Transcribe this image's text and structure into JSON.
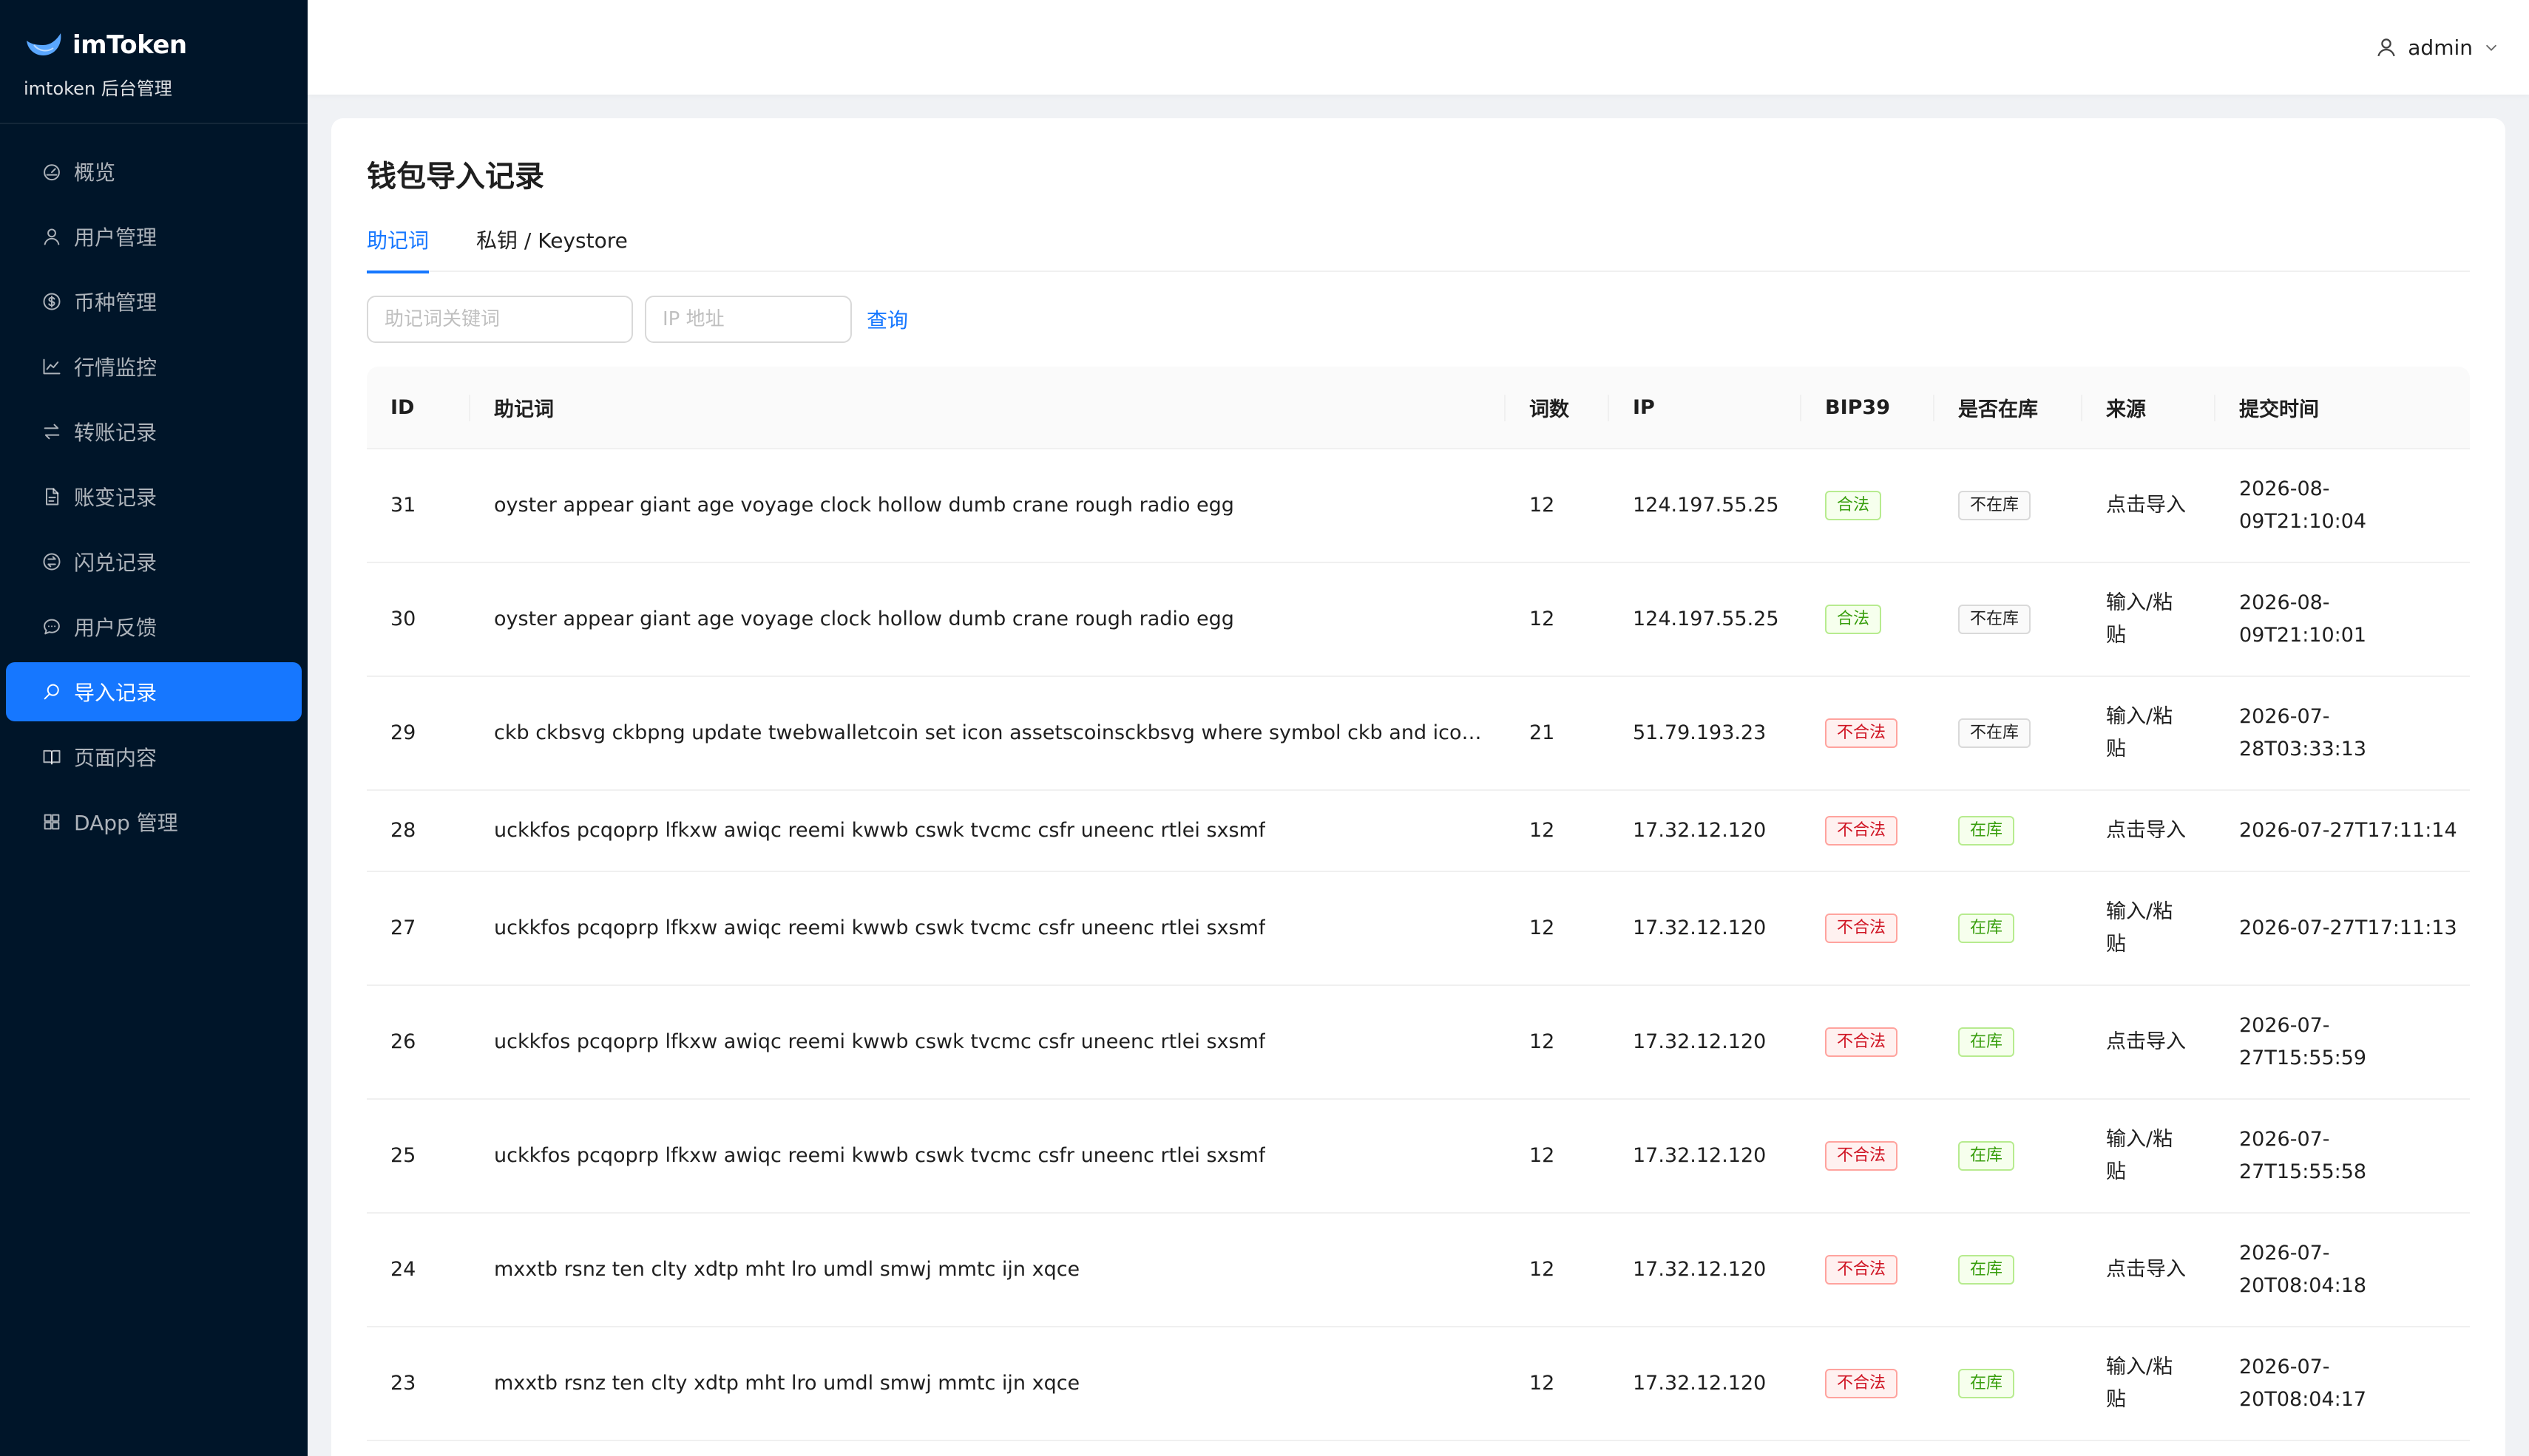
{
  "brand": {
    "name": "imToken",
    "subtitle": "imtoken 后台管理"
  },
  "sidebar": {
    "items": [
      {
        "label": "概览",
        "icon": "dashboard-icon"
      },
      {
        "label": "用户管理",
        "icon": "user-icon"
      },
      {
        "label": "币种管理",
        "icon": "dollar-circle-icon"
      },
      {
        "label": "行情监控",
        "icon": "line-chart-icon"
      },
      {
        "label": "转账记录",
        "icon": "swap-icon"
      },
      {
        "label": "账变记录",
        "icon": "file-text-icon"
      },
      {
        "label": "闪兑记录",
        "icon": "transaction-icon"
      },
      {
        "label": "用户反馈",
        "icon": "message-icon"
      },
      {
        "label": "导入记录",
        "icon": "search-icon",
        "active": true
      },
      {
        "label": "页面内容",
        "icon": "read-icon"
      },
      {
        "label": "DApp 管理",
        "icon": "appstore-icon"
      }
    ]
  },
  "header": {
    "user": "admin"
  },
  "main": {
    "title": "钱包导入记录",
    "tabs": [
      {
        "label": "助记词",
        "active": true
      },
      {
        "label": "私钥 / Keystore",
        "active": false
      }
    ],
    "filters": {
      "keyword_placeholder": "助记词关键词",
      "ip_placeholder": "IP 地址",
      "query_label": "查询"
    },
    "table": {
      "columns": [
        "ID",
        "助记词",
        "词数",
        "IP",
        "BIP39",
        "是否在库",
        "来源",
        "提交时间"
      ],
      "rows": [
        {
          "id": "31",
          "mnemonic": "oyster appear giant age voyage clock hollow dumb crane rough radio egg",
          "words": "12",
          "ip": "124.197.55.25",
          "bip39": "合法",
          "bip39_status": "valid",
          "in_lib": "不在库",
          "in_lib_status": "no",
          "source": [
            "点击导入"
          ],
          "time": [
            "2026-08-",
            "09T21:10:04"
          ]
        },
        {
          "id": "30",
          "mnemonic": "oyster appear giant age voyage clock hollow dumb crane rough radio egg",
          "words": "12",
          "ip": "124.197.55.25",
          "bip39": "合法",
          "bip39_status": "valid",
          "in_lib": "不在库",
          "in_lib_status": "no",
          "source": [
            "输入/粘",
            "贴"
          ],
          "time": [
            "2026-08-",
            "09T21:10:01"
          ]
        },
        {
          "id": "29",
          "mnemonic": "ckb ckbsvg ckbpng update twebwalletcoin set icon assetscoinsckbsvg where symbol ckb and icon is null",
          "words": "21",
          "ip": "51.79.193.23",
          "bip39": "不合法",
          "bip39_status": "invalid",
          "in_lib": "不在库",
          "in_lib_status": "no",
          "source": [
            "输入/粘",
            "贴"
          ],
          "time": [
            "2026-07-",
            "28T03:33:13"
          ]
        },
        {
          "id": "28",
          "mnemonic": "uckkfos pcqoprp lfkxw awiqc reemi kwwb cswk tvcmc csfr uneenc rtlei sxsmf",
          "words": "12",
          "ip": "17.32.12.120",
          "bip39": "不合法",
          "bip39_status": "invalid",
          "in_lib": "在库",
          "in_lib_status": "yes",
          "source": [
            "点击导入"
          ],
          "time": [
            "2026-07-27T17:11:14"
          ]
        },
        {
          "id": "27",
          "mnemonic": "uckkfos pcqoprp lfkxw awiqc reemi kwwb cswk tvcmc csfr uneenc rtlei sxsmf",
          "words": "12",
          "ip": "17.32.12.120",
          "bip39": "不合法",
          "bip39_status": "invalid",
          "in_lib": "在库",
          "in_lib_status": "yes",
          "source": [
            "输入/粘",
            "贴"
          ],
          "time": [
            "2026-07-27T17:11:13"
          ]
        },
        {
          "id": "26",
          "mnemonic": "uckkfos pcqoprp lfkxw awiqc reemi kwwb cswk tvcmc csfr uneenc rtlei sxsmf",
          "words": "12",
          "ip": "17.32.12.120",
          "bip39": "不合法",
          "bip39_status": "invalid",
          "in_lib": "在库",
          "in_lib_status": "yes",
          "source": [
            "点击导入"
          ],
          "time": [
            "2026-07-",
            "27T15:55:59"
          ]
        },
        {
          "id": "25",
          "mnemonic": "uckkfos pcqoprp lfkxw awiqc reemi kwwb cswk tvcmc csfr uneenc rtlei sxsmf",
          "words": "12",
          "ip": "17.32.12.120",
          "bip39": "不合法",
          "bip39_status": "invalid",
          "in_lib": "在库",
          "in_lib_status": "yes",
          "source": [
            "输入/粘",
            "贴"
          ],
          "time": [
            "2026-07-",
            "27T15:55:58"
          ]
        },
        {
          "id": "24",
          "mnemonic": "mxxtb rsnz ten clty xdtp mht lro umdl smwj mmtc ijn xqce",
          "words": "12",
          "ip": "17.32.12.120",
          "bip39": "不合法",
          "bip39_status": "invalid",
          "in_lib": "在库",
          "in_lib_status": "yes",
          "source": [
            "点击导入"
          ],
          "time": [
            "2026-07-",
            "20T08:04:18"
          ]
        },
        {
          "id": "23",
          "mnemonic": "mxxtb rsnz ten clty xdtp mht lro umdl smwj mmtc ijn xqce",
          "words": "12",
          "ip": "17.32.12.120",
          "bip39": "不合法",
          "bip39_status": "invalid",
          "in_lib": "在库",
          "in_lib_status": "yes",
          "source": [
            "输入/粘",
            "贴"
          ],
          "time": [
            "2026-07-",
            "20T08:04:17"
          ]
        }
      ]
    }
  },
  "colors": {
    "sidebar_bg": "#001529",
    "accent": "#1677ff",
    "valid": "#389e0d",
    "invalid": "#cf1322"
  }
}
